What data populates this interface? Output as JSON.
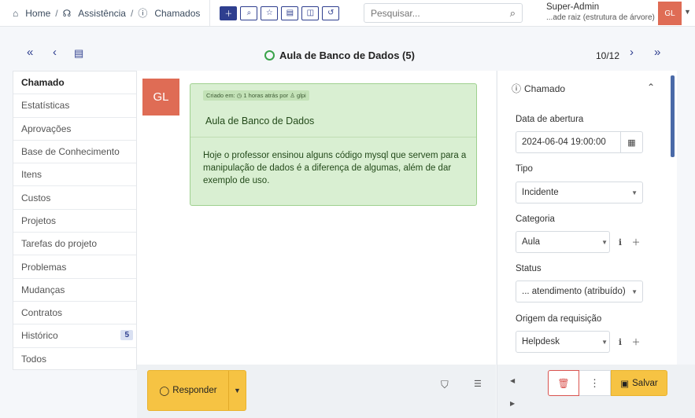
{
  "breadcrumbs": {
    "home": "Home",
    "assistencia": "Assistência",
    "chamados": "Chamados"
  },
  "search": {
    "placeholder": "Pesquisar..."
  },
  "user": {
    "name": "Super-Admin",
    "entity": "...ade raiz (estrutura de árvore)",
    "initials": "GL"
  },
  "ticket": {
    "title": "Aula de Banco de Dados (5)",
    "position": "10/12"
  },
  "tabs": [
    {
      "label": "Chamado"
    },
    {
      "label": "Estatísticas"
    },
    {
      "label": "Aprovações"
    },
    {
      "label": "Base de Conhecimento"
    },
    {
      "label": "Itens"
    },
    {
      "label": "Custos"
    },
    {
      "label": "Projetos"
    },
    {
      "label": "Tarefas do projeto"
    },
    {
      "label": "Problemas"
    },
    {
      "label": "Mudanças"
    },
    {
      "label": "Contratos"
    },
    {
      "label": "Histórico",
      "badge": "5"
    },
    {
      "label": "Todos"
    }
  ],
  "timeline": {
    "avatar": "GL",
    "meta_prefix": "Criado em:",
    "meta_time": "1 horas atrás por",
    "meta_user": "glpi",
    "title": "Aula de Banco de Dados",
    "content": "Hoje o professor ensinou alguns código mysql que servem para a manipulação de dados  é a diferença de algumas, além de dar exemplo de uso."
  },
  "actions": {
    "respond": "Responder",
    "save": "Salvar"
  },
  "panel": {
    "heading": "Chamado",
    "date_label": "Data de abertura",
    "date_value": "2024-06-04 19:00:00",
    "type_label": "Tipo",
    "type_value": "Incidente",
    "category_label": "Categoria",
    "category_value": "Aula",
    "status_label": "Status",
    "status_value": "... atendimento (atribuído)",
    "origin_label": "Origem da requisição",
    "origin_value": "Helpdesk"
  },
  "colors": {
    "accent": "#2f3f8f",
    "avatar": "#df6c55",
    "bubble": "#d9efd2",
    "button": "#f6c343",
    "status_ring": "#3aa34a"
  }
}
